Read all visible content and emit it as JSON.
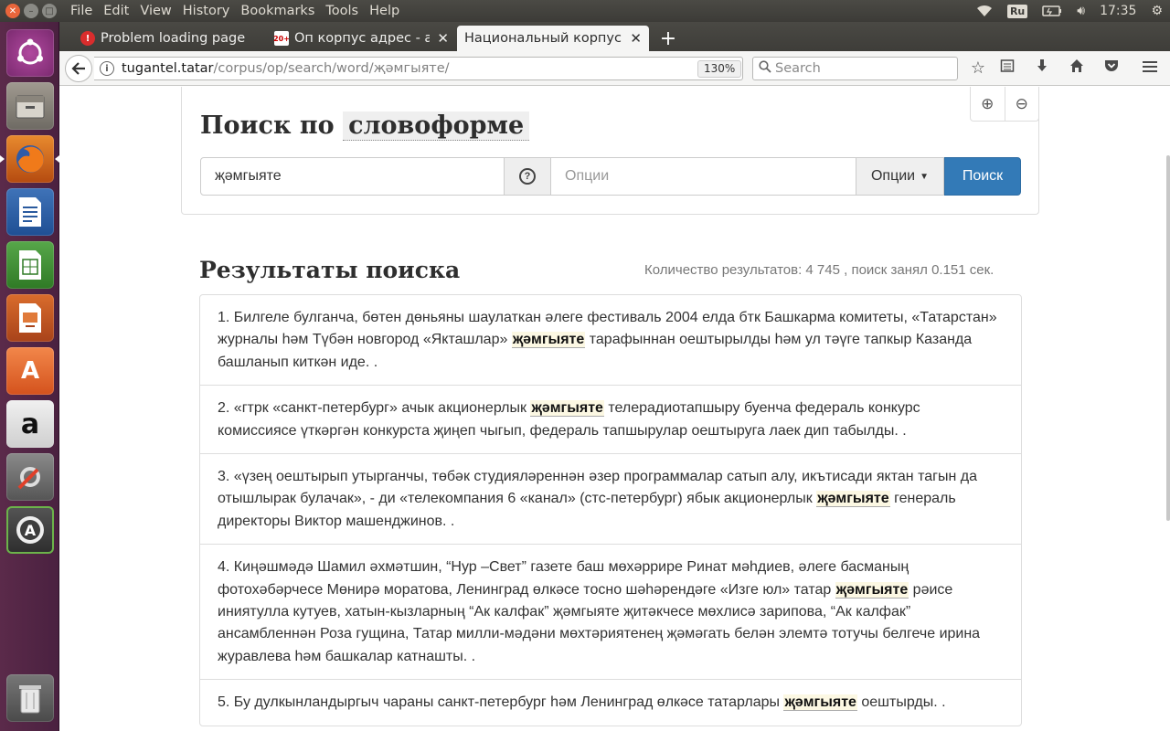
{
  "top_panel": {
    "menus": [
      "File",
      "Edit",
      "View",
      "History",
      "Bookmarks",
      "Tools",
      "Help"
    ],
    "keyboard_layout": "Ru",
    "clock": "17:35"
  },
  "launcher": {
    "items": [
      "ubuntu-dash",
      "files",
      "firefox",
      "libreoffice-writer",
      "libreoffice-calc",
      "libreoffice-impress",
      "ubuntu-software",
      "amazon",
      "system-settings",
      "software-updater",
      "trash"
    ]
  },
  "tabs": [
    {
      "title": "Problem loading page",
      "icon": "!"
    },
    {
      "title": "Оп корпус адрес - amо",
      "icon": "20+"
    },
    {
      "title": "Национальный корпус та"
    }
  ],
  "nav": {
    "url_host": "tugantel.tatar",
    "url_path": "/corpus/op/search/word/җәмгыяте/",
    "zoom": "130%",
    "search_placeholder": "Search"
  },
  "search_panel": {
    "heading_prefix": "Поиск по",
    "heading_mode": "словоформе",
    "query": "җәмгыяте",
    "options_placeholder": "Опции",
    "options_button": "Опции",
    "search_button": "Поиск"
  },
  "results": {
    "heading": "Результаты поиска",
    "count_text": "Количество результатов: 4 745 , поиск занял 0.151 сек.",
    "items": [
      {
        "before": "1. Билгеле булганча, бөтен дөньяны шаулаткан әлеге фестиваль 2004 елда бтк Башкарма комитеты, «Татарстан» журналы һәм Түбән новгород «Якташлар» ",
        "keyword": "җәмгыяте",
        "after": " тарафыннан оештырылды һәм ул тәүге тапкыр Казанда башланып киткән иде. ."
      },
      {
        "before": "2. «гтрк «санкт-петербург» ачык акционерлык ",
        "keyword": "җәмгыяте",
        "after": " телерадиотапшыру буенча федераль конкурс комиссиясе үткәргән конкурста җиңеп чыгып, федераль тапшырулар оештыруга лаек дип табылды. ."
      },
      {
        "before": "3. «үзең оештырып утырганчы, төбәк студияләреннән әзер программалар сатып алу, икътисади яктан тагын да отышлырак булачак», - ди «телекомпания 6 «канал» (стс-петербург) ябык акционерлык ",
        "keyword": "җәмгыяте",
        "after": " генераль директоры Виктор машенджинов. ."
      },
      {
        "before": "4. Киңәшмәдә Шамил әхмәтшин, “Нур –Свет” газете баш мөхәррире Ринат мәһдиев, әлеге басманың фотохәбәрчесе Мөнирә моратова, Ленинград өлкәсе тосно шәһәрендәге «Изге юл» татар ",
        "keyword": "җәмгыяте",
        "after": " рәисе иниятулла кутуев, хатын-кызларның “Ак калфак” җәмгыяте җитәкчесе мөхлисә зарипова, “Ак калфак” ансамбленнән Роза гущина, Татар милли-мәдәни мөхтәриятенең җәмәгать белән элемтә тотучы белгече ирина журавлева һәм башкалар катнашты. ."
      },
      {
        "before": "5. Бу дулкынландыргыч чараны санкт-петербург һәм Ленинград өлкәсе татарлары ",
        "keyword": "җәмгыяте",
        "after": " оештырды. ."
      }
    ]
  }
}
